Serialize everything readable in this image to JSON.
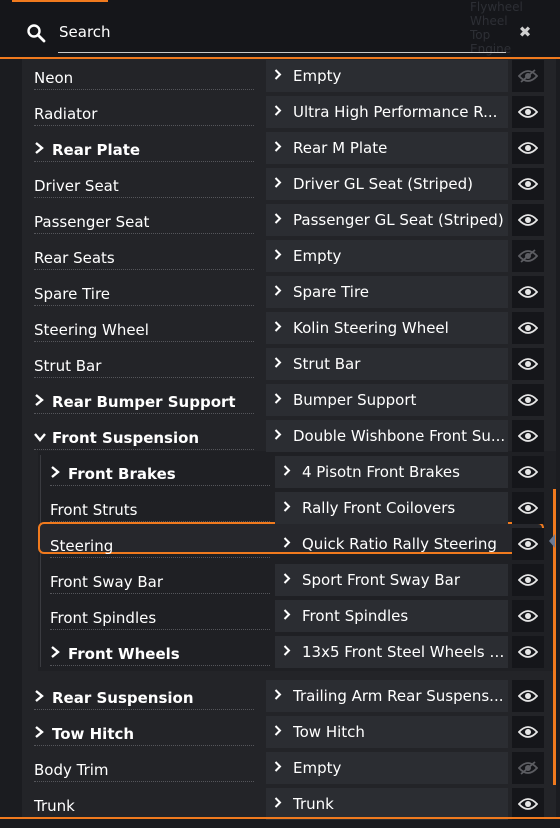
{
  "search": {
    "placeholder": "Search",
    "clear_glyph": "✖"
  },
  "background_text": [
    "Flywheel",
    "Wheel",
    "Top",
    "Engine"
  ],
  "colors": {
    "accent": "#f07a1e",
    "panel": "#232428",
    "value_bg": "#2b2d32",
    "eye_bg": "#15161a"
  },
  "rows": [
    {
      "label": "Neon",
      "value": "Empty",
      "bold": false,
      "expand": "",
      "indent": 0,
      "visible": false
    },
    {
      "label": "Radiator",
      "value": "Ultra High Performance R...",
      "bold": false,
      "expand": "",
      "indent": 0,
      "visible": true
    },
    {
      "label": "Rear Plate",
      "value": "Rear M Plate",
      "bold": true,
      "expand": "right",
      "indent": 0,
      "visible": true
    },
    {
      "label": "Driver Seat",
      "value": "Driver GL Seat (Striped)",
      "bold": false,
      "expand": "",
      "indent": 0,
      "visible": true
    },
    {
      "label": "Passenger Seat",
      "value": "Passenger GL Seat (Striped)",
      "bold": false,
      "expand": "",
      "indent": 0,
      "visible": true
    },
    {
      "label": "Rear Seats",
      "value": "Empty",
      "bold": false,
      "expand": "",
      "indent": 0,
      "visible": false
    },
    {
      "label": "Spare Tire",
      "value": "Spare Tire",
      "bold": false,
      "expand": "",
      "indent": 0,
      "visible": true
    },
    {
      "label": "Steering Wheel",
      "value": "Kolin Steering Wheel",
      "bold": false,
      "expand": "",
      "indent": 0,
      "visible": true
    },
    {
      "label": "Strut Bar",
      "value": "Strut Bar",
      "bold": false,
      "expand": "",
      "indent": 0,
      "visible": true
    },
    {
      "label": "Rear Bumper Support",
      "value": "Bumper Support",
      "bold": true,
      "expand": "right",
      "indent": 0,
      "visible": true
    },
    {
      "label": "Front Suspension",
      "value": "Double Wishbone Front Su...",
      "bold": true,
      "expand": "down",
      "indent": 0,
      "visible": true
    },
    {
      "label": "Front Brakes",
      "value": "4 Pisotn Front Brakes",
      "bold": true,
      "expand": "right",
      "indent": 1,
      "visible": true
    },
    {
      "label": "Front Struts",
      "value": "Rally Front Coilovers",
      "bold": false,
      "expand": "",
      "indent": 1,
      "visible": true
    },
    {
      "label": "Steering",
      "value": "Quick Ratio Rally Steering",
      "bold": false,
      "expand": "",
      "indent": 1,
      "visible": true,
      "selected": true
    },
    {
      "label": "Front Sway Bar",
      "value": "Sport Front Sway Bar",
      "bold": false,
      "expand": "",
      "indent": 1,
      "visible": true
    },
    {
      "label": "Front Spindles",
      "value": "Front Spindles",
      "bold": false,
      "expand": "",
      "indent": 1,
      "visible": true
    },
    {
      "label": "Front Wheels",
      "value": "13x5 Front Steel Wheels (...",
      "bold": true,
      "expand": "right",
      "indent": 1,
      "visible": true
    },
    {
      "label": "Rear Suspension",
      "value": "Trailing Arm Rear Suspens...",
      "bold": true,
      "expand": "right",
      "indent": 0,
      "visible": true
    },
    {
      "label": "Tow Hitch",
      "value": "Tow Hitch",
      "bold": true,
      "expand": "right",
      "indent": 0,
      "visible": true
    },
    {
      "label": "Body Trim",
      "value": "Empty",
      "bold": false,
      "expand": "",
      "indent": 0,
      "visible": false
    },
    {
      "label": "Trunk",
      "value": "Trunk",
      "bold": false,
      "expand": "",
      "indent": 0,
      "visible": true
    }
  ]
}
